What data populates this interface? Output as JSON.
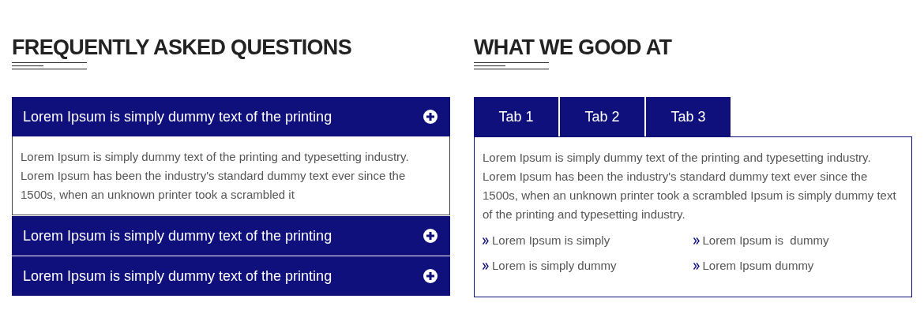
{
  "faq": {
    "title": "FREQUENTLY ASKED QUESTIONS",
    "items": [
      {
        "question": "Lorem Ipsum is simply dummy text of the printing",
        "answer": "Lorem Ipsum is simply dummy text of the printing and typesetting industry. Lorem Ipsum has been the industry's standard dummy text ever since the 1500s, when an unknown printer took a scrambled it"
      },
      {
        "question": "Lorem Ipsum is simply dummy text of the printing"
      },
      {
        "question": "Lorem Ipsum is simply dummy text of the printing"
      }
    ]
  },
  "skills": {
    "title": "WHAT WE GOOD AT",
    "tabs": [
      "Tab 1",
      "Tab 2",
      "Tab 3"
    ],
    "panel": {
      "text": "Lorem Ipsum is simply dummy text of the printing and typesetting industry. Lorem Ipsum has been the industry's standard dummy text ever since the 1500s, when an unknown printer took a scrambled Ipsum is simply dummy text of the printing and typesetting industry.",
      "list": [
        "Lorem Ipsum is simply",
        "Lorem Ipsum is  dummy",
        "Lorem is simply dummy",
        "Lorem Ipsum dummy"
      ]
    }
  }
}
